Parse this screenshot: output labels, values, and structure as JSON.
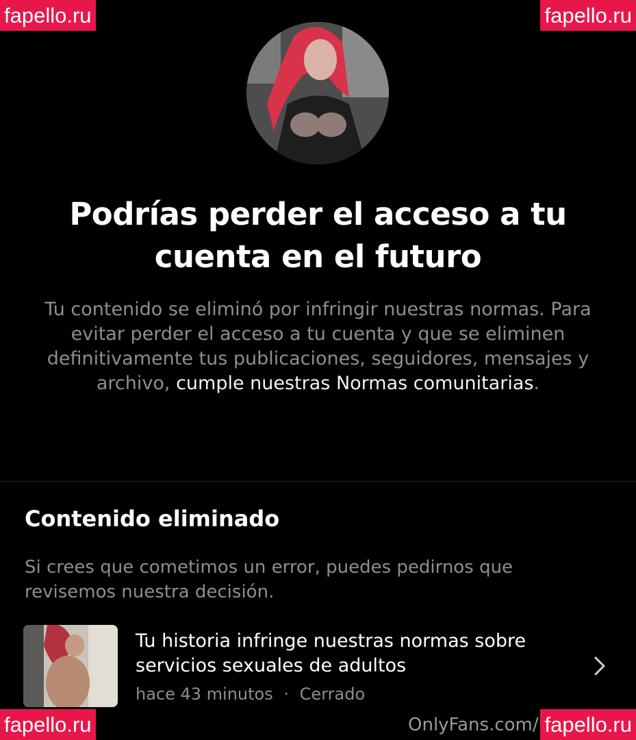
{
  "watermarks": {
    "top_left": "fapello.ru",
    "top_right": "fapello.ru",
    "bottom_left": "fapello.ru",
    "bottom_right": "fapello.ru"
  },
  "header": {
    "title": "Podrías perder el acceso a tu cuenta en el futuro",
    "warning_text": "Tu contenido se eliminó por infringir nuestras normas. Para evitar perder el acceso a tu cuenta y que se eliminen definitivamente tus publicaciones, seguidores, mensajes y archivo, ",
    "warning_link": "cumple nuestras Normas comunitarias",
    "warning_end": "."
  },
  "section": {
    "title": "Contenido eliminado",
    "subtitle": "Si crees que cometimos un error, puedes pedirnos que revisemos nuestra decisión."
  },
  "items": [
    {
      "title": "Tu historia infringe nuestras normas sobre servicios sexuales de adultos",
      "time": "hace 43 minutos",
      "separator": "·",
      "status": "Cerrado"
    }
  ],
  "footer_mark": "OnlyFans.com/",
  "icons": {
    "chevron": "chevron-right-icon",
    "avatar": "profile-avatar"
  },
  "colors": {
    "background": "#000000",
    "secondary_text": "#8e8e8e",
    "watermark": "#e8174b"
  }
}
